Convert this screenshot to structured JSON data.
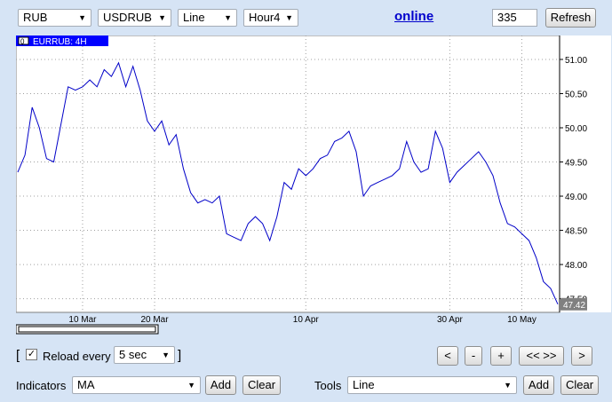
{
  "toolbar": {
    "currency": "RUB",
    "symbol": "USDRUB",
    "chart_type": "Line",
    "timeframe": "Hour4",
    "online_link": "online",
    "bars_value": "335",
    "refresh_label": "Refresh"
  },
  "chart_panel": {
    "legend_badge": "0",
    "legend_text": "EURRUB: 4H",
    "current_price": "47.42"
  },
  "controls": {
    "bracket_open": "[",
    "bracket_close": "]",
    "reload_label": "Reload every",
    "reload_checked": true,
    "reload_interval": "5 sec",
    "nav_first": "<",
    "nav_zoom_out": "-",
    "nav_zoom_in": "+",
    "nav_fit": "<< >>",
    "nav_last": ">",
    "indicators_label": "Indicators",
    "indicator_value": "MA",
    "tools_label": "Tools",
    "tool_value": "Line",
    "add_label": "Add",
    "clear_label": "Clear"
  },
  "colors": {
    "line": "#0000c8",
    "legend_bg": "#0000ff",
    "price_badge_bg": "#808080",
    "grid": "#a0a0a0"
  },
  "chart_data": {
    "type": "line",
    "title": "EURRUB: 4H",
    "xlabel": "",
    "ylabel": "",
    "ylim": [
      47.3,
      51.35
    ],
    "y_ticks": [
      "51.00",
      "50.50",
      "50.00",
      "49.50",
      "49.00",
      "48.50",
      "48.00",
      "47.50"
    ],
    "y_tick_values": [
      51.0,
      50.5,
      50.0,
      49.5,
      49.0,
      48.5,
      48.0,
      47.5
    ],
    "x_range": [
      "2015-03-01",
      "2015-05-15"
    ],
    "x_ticks": [
      "10 Mar",
      "20 Mar",
      "10 Apr",
      "30 Apr",
      "10 May"
    ],
    "x_tick_dates": [
      "2015-03-10",
      "2015-03-20",
      "2015-04-10",
      "2015-04-30",
      "2015-05-10"
    ],
    "grid": true,
    "legend": "top-left",
    "series": [
      {
        "name": "EURRUB",
        "points": [
          [
            "2015-03-01",
            49.35
          ],
          [
            "2015-03-02",
            49.6
          ],
          [
            "2015-03-03",
            50.3
          ],
          [
            "2015-03-04",
            50.0
          ],
          [
            "2015-03-05",
            49.55
          ],
          [
            "2015-03-06",
            49.5
          ],
          [
            "2015-03-07",
            50.05
          ],
          [
            "2015-03-08",
            50.6
          ],
          [
            "2015-03-09",
            50.55
          ],
          [
            "2015-03-10",
            50.6
          ],
          [
            "2015-03-11",
            50.7
          ],
          [
            "2015-03-12",
            50.6
          ],
          [
            "2015-03-13",
            50.85
          ],
          [
            "2015-03-14",
            50.75
          ],
          [
            "2015-03-15",
            50.95
          ],
          [
            "2015-03-16",
            50.6
          ],
          [
            "2015-03-17",
            50.9
          ],
          [
            "2015-03-18",
            50.55
          ],
          [
            "2015-03-19",
            50.1
          ],
          [
            "2015-03-20",
            49.95
          ],
          [
            "2015-03-21",
            50.1
          ],
          [
            "2015-03-22",
            49.75
          ],
          [
            "2015-03-23",
            49.9
          ],
          [
            "2015-03-24",
            49.4
          ],
          [
            "2015-03-25",
            49.05
          ],
          [
            "2015-03-26",
            48.9
          ],
          [
            "2015-03-27",
            48.95
          ],
          [
            "2015-03-28",
            48.9
          ],
          [
            "2015-03-29",
            49.0
          ],
          [
            "2015-03-30",
            48.45
          ],
          [
            "2015-03-31",
            48.4
          ],
          [
            "2015-04-01",
            48.35
          ],
          [
            "2015-04-02",
            48.6
          ],
          [
            "2015-04-03",
            48.7
          ],
          [
            "2015-04-04",
            48.6
          ],
          [
            "2015-04-05",
            48.35
          ],
          [
            "2015-04-06",
            48.7
          ],
          [
            "2015-04-07",
            49.2
          ],
          [
            "2015-04-08",
            49.1
          ],
          [
            "2015-04-09",
            49.4
          ],
          [
            "2015-04-10",
            49.3
          ],
          [
            "2015-04-11",
            49.4
          ],
          [
            "2015-04-12",
            49.55
          ],
          [
            "2015-04-13",
            49.6
          ],
          [
            "2015-04-14",
            49.8
          ],
          [
            "2015-04-15",
            49.85
          ],
          [
            "2015-04-16",
            49.95
          ],
          [
            "2015-04-17",
            49.65
          ],
          [
            "2015-04-18",
            49.0
          ],
          [
            "2015-04-19",
            49.15
          ],
          [
            "2015-04-20",
            49.2
          ],
          [
            "2015-04-21",
            49.25
          ],
          [
            "2015-04-22",
            49.3
          ],
          [
            "2015-04-23",
            49.4
          ],
          [
            "2015-04-24",
            49.8
          ],
          [
            "2015-04-25",
            49.5
          ],
          [
            "2015-04-26",
            49.35
          ],
          [
            "2015-04-27",
            49.4
          ],
          [
            "2015-04-28",
            49.95
          ],
          [
            "2015-04-29",
            49.7
          ],
          [
            "2015-04-30",
            49.2
          ],
          [
            "2015-05-01",
            49.35
          ],
          [
            "2015-05-02",
            49.45
          ],
          [
            "2015-05-03",
            49.55
          ],
          [
            "2015-05-04",
            49.65
          ],
          [
            "2015-05-05",
            49.5
          ],
          [
            "2015-05-06",
            49.3
          ],
          [
            "2015-05-07",
            48.9
          ],
          [
            "2015-05-08",
            48.6
          ],
          [
            "2015-05-09",
            48.55
          ],
          [
            "2015-05-10",
            48.45
          ],
          [
            "2015-05-11",
            48.35
          ],
          [
            "2015-05-12",
            48.1
          ],
          [
            "2015-05-13",
            47.75
          ],
          [
            "2015-05-14",
            47.65
          ],
          [
            "2015-05-15",
            47.42
          ]
        ]
      }
    ]
  }
}
